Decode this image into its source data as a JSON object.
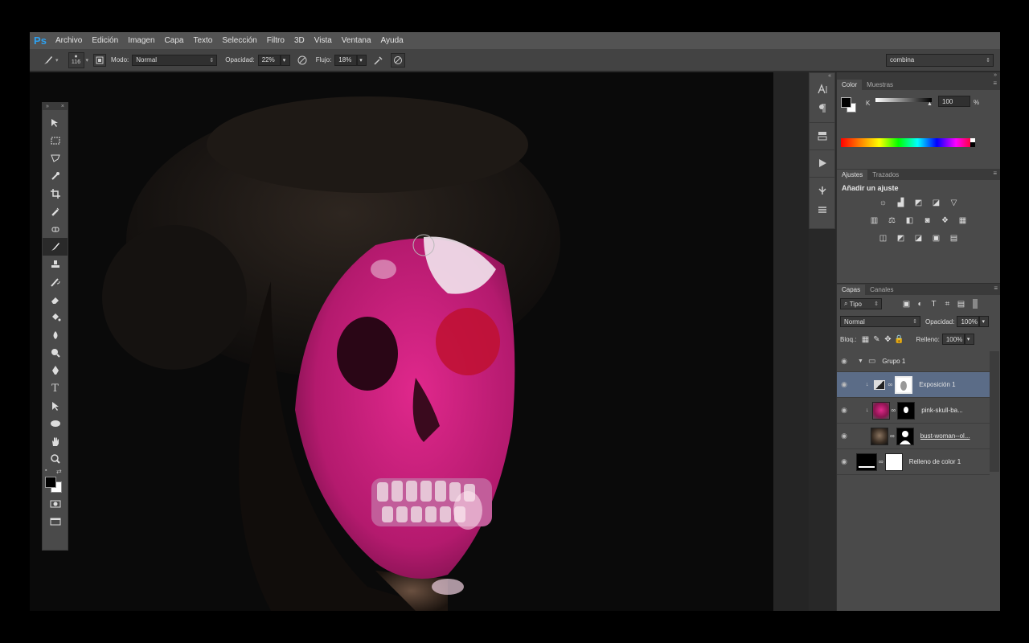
{
  "app": {
    "logo": "Ps"
  },
  "menu": [
    "Archivo",
    "Edición",
    "Imagen",
    "Capa",
    "Texto",
    "Selección",
    "Filtro",
    "3D",
    "Vista",
    "Ventana",
    "Ayuda"
  ],
  "options": {
    "brush_size": "116",
    "mode_label": "Modo:",
    "mode_value": "Normal",
    "opacity_label": "Opacidad:",
    "opacity_value": "22%",
    "flow_label": "Flujo:",
    "flow_value": "18%",
    "workspace": "combina"
  },
  "color_panel": {
    "tabs": [
      "Color",
      "Muestras"
    ],
    "channel": "K",
    "value": "100",
    "unit": "%"
  },
  "adjustments_panel": {
    "tabs": [
      "Ajustes",
      "Trazados"
    ],
    "title": "Añadir un ajuste"
  },
  "layers_panel": {
    "tabs": [
      "Capas",
      "Canales"
    ],
    "filter": "Tipo",
    "blend_mode": "Normal",
    "opacity_label": "Opacidad:",
    "opacity": "100%",
    "lock_label": "Bloq.:",
    "fill_label": "Relleno:",
    "fill": "100%",
    "layers": [
      {
        "name": "Grupo 1",
        "type": "group"
      },
      {
        "name": "Exposición 1",
        "type": "adjustment"
      },
      {
        "name": "pink-skull-ba...",
        "type": "image"
      },
      {
        "name": "bust-woman--ol...",
        "type": "image"
      },
      {
        "name": "Relleno de color 1",
        "type": "fill"
      }
    ]
  },
  "icons": {
    "tools": [
      "move-icon",
      "marquee-icon",
      "lasso-icon",
      "quick-select-icon",
      "crop-icon",
      "eyedropper-icon",
      "healing-icon",
      "brush-icon",
      "stamp-icon",
      "history-brush-icon",
      "eraser-icon",
      "bucket-icon",
      "blur-icon",
      "dodge-icon",
      "pen-icon",
      "type-icon",
      "path-select-icon",
      "ellipse-icon",
      "hand-icon",
      "zoom-icon"
    ]
  }
}
